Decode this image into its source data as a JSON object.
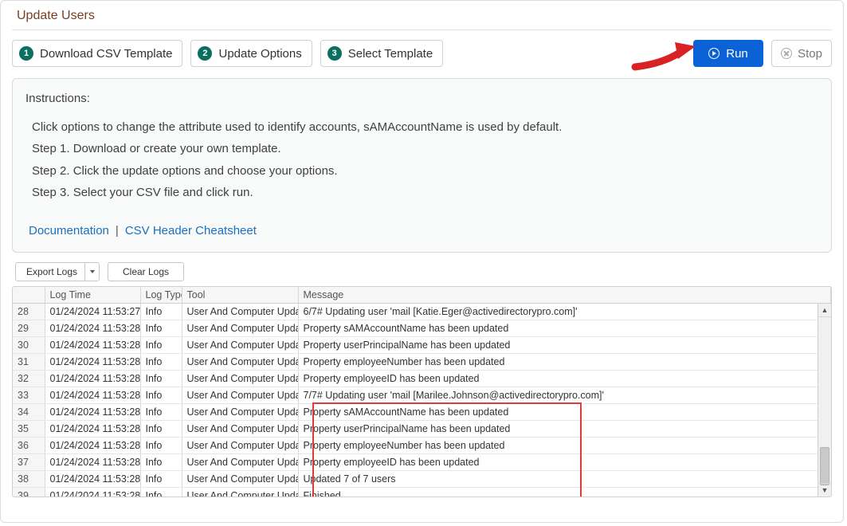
{
  "page": {
    "title": "Update Users"
  },
  "steps": {
    "s1": {
      "num": "1",
      "label": "Download CSV Template"
    },
    "s2": {
      "num": "2",
      "label": "Update Options"
    },
    "s3": {
      "num": "3",
      "label": "Select Template"
    }
  },
  "actions": {
    "run": "Run",
    "stop": "Stop"
  },
  "instructions": {
    "title": "Instructions:",
    "line1": "Click options to change the attribute used to identify accounts, sAMAccountName is used by default.",
    "line2": "Step 1. Download or create your own template.",
    "line3": "Step 2. Click the update options and choose your options.",
    "line4": "Step 3. Select your CSV file and click run.",
    "doc_link": "Documentation",
    "cheat_link": "CSV Header Cheatsheet"
  },
  "controls": {
    "export": "Export Logs",
    "clear": "Clear Logs"
  },
  "grid": {
    "headers": {
      "logtime": "Log Time",
      "logtype": "Log Type",
      "tool": "Tool",
      "message": "Message"
    },
    "rows": [
      {
        "n": "28",
        "time": "01/24/2024 11:53:27",
        "type": "Info",
        "tool": "User And Computer Updater",
        "msg": "6/7# Updating user 'mail [Katie.Eger@activedirectorypro.com]'"
      },
      {
        "n": "29",
        "time": "01/24/2024 11:53:28",
        "type": "Info",
        "tool": "User And Computer Updater",
        "msg": "Property sAMAccountName has been updated"
      },
      {
        "n": "30",
        "time": "01/24/2024 11:53:28",
        "type": "Info",
        "tool": "User And Computer Updater",
        "msg": "Property userPrincipalName has been updated"
      },
      {
        "n": "31",
        "time": "01/24/2024 11:53:28",
        "type": "Info",
        "tool": "User And Computer Updater",
        "msg": "Property employeeNumber has been updated"
      },
      {
        "n": "32",
        "time": "01/24/2024 11:53:28",
        "type": "Info",
        "tool": "User And Computer Updater",
        "msg": "Property employeeID has been updated"
      },
      {
        "n": "33",
        "time": "01/24/2024 11:53:28",
        "type": "Info",
        "tool": "User And Computer Updater",
        "msg": "7/7# Updating user 'mail [Marilee.Johnson@activedirectorypro.com]'"
      },
      {
        "n": "34",
        "time": "01/24/2024 11:53:28",
        "type": "Info",
        "tool": "User And Computer Updater",
        "msg": "Property sAMAccountName has been updated"
      },
      {
        "n": "35",
        "time": "01/24/2024 11:53:28",
        "type": "Info",
        "tool": "User And Computer Updater",
        "msg": "Property userPrincipalName has been updated"
      },
      {
        "n": "36",
        "time": "01/24/2024 11:53:28",
        "type": "Info",
        "tool": "User And Computer Updater",
        "msg": "Property employeeNumber has been updated"
      },
      {
        "n": "37",
        "time": "01/24/2024 11:53:28",
        "type": "Info",
        "tool": "User And Computer Updater",
        "msg": "Property employeeID has been updated"
      },
      {
        "n": "38",
        "time": "01/24/2024 11:53:28",
        "type": "Info",
        "tool": "User And Computer Updater",
        "msg": "Updated 7 of 7 users"
      },
      {
        "n": "39",
        "time": "01/24/2024 11:53:28",
        "type": "Info",
        "tool": "User And Computer Updater",
        "msg": "Finished"
      }
    ]
  }
}
